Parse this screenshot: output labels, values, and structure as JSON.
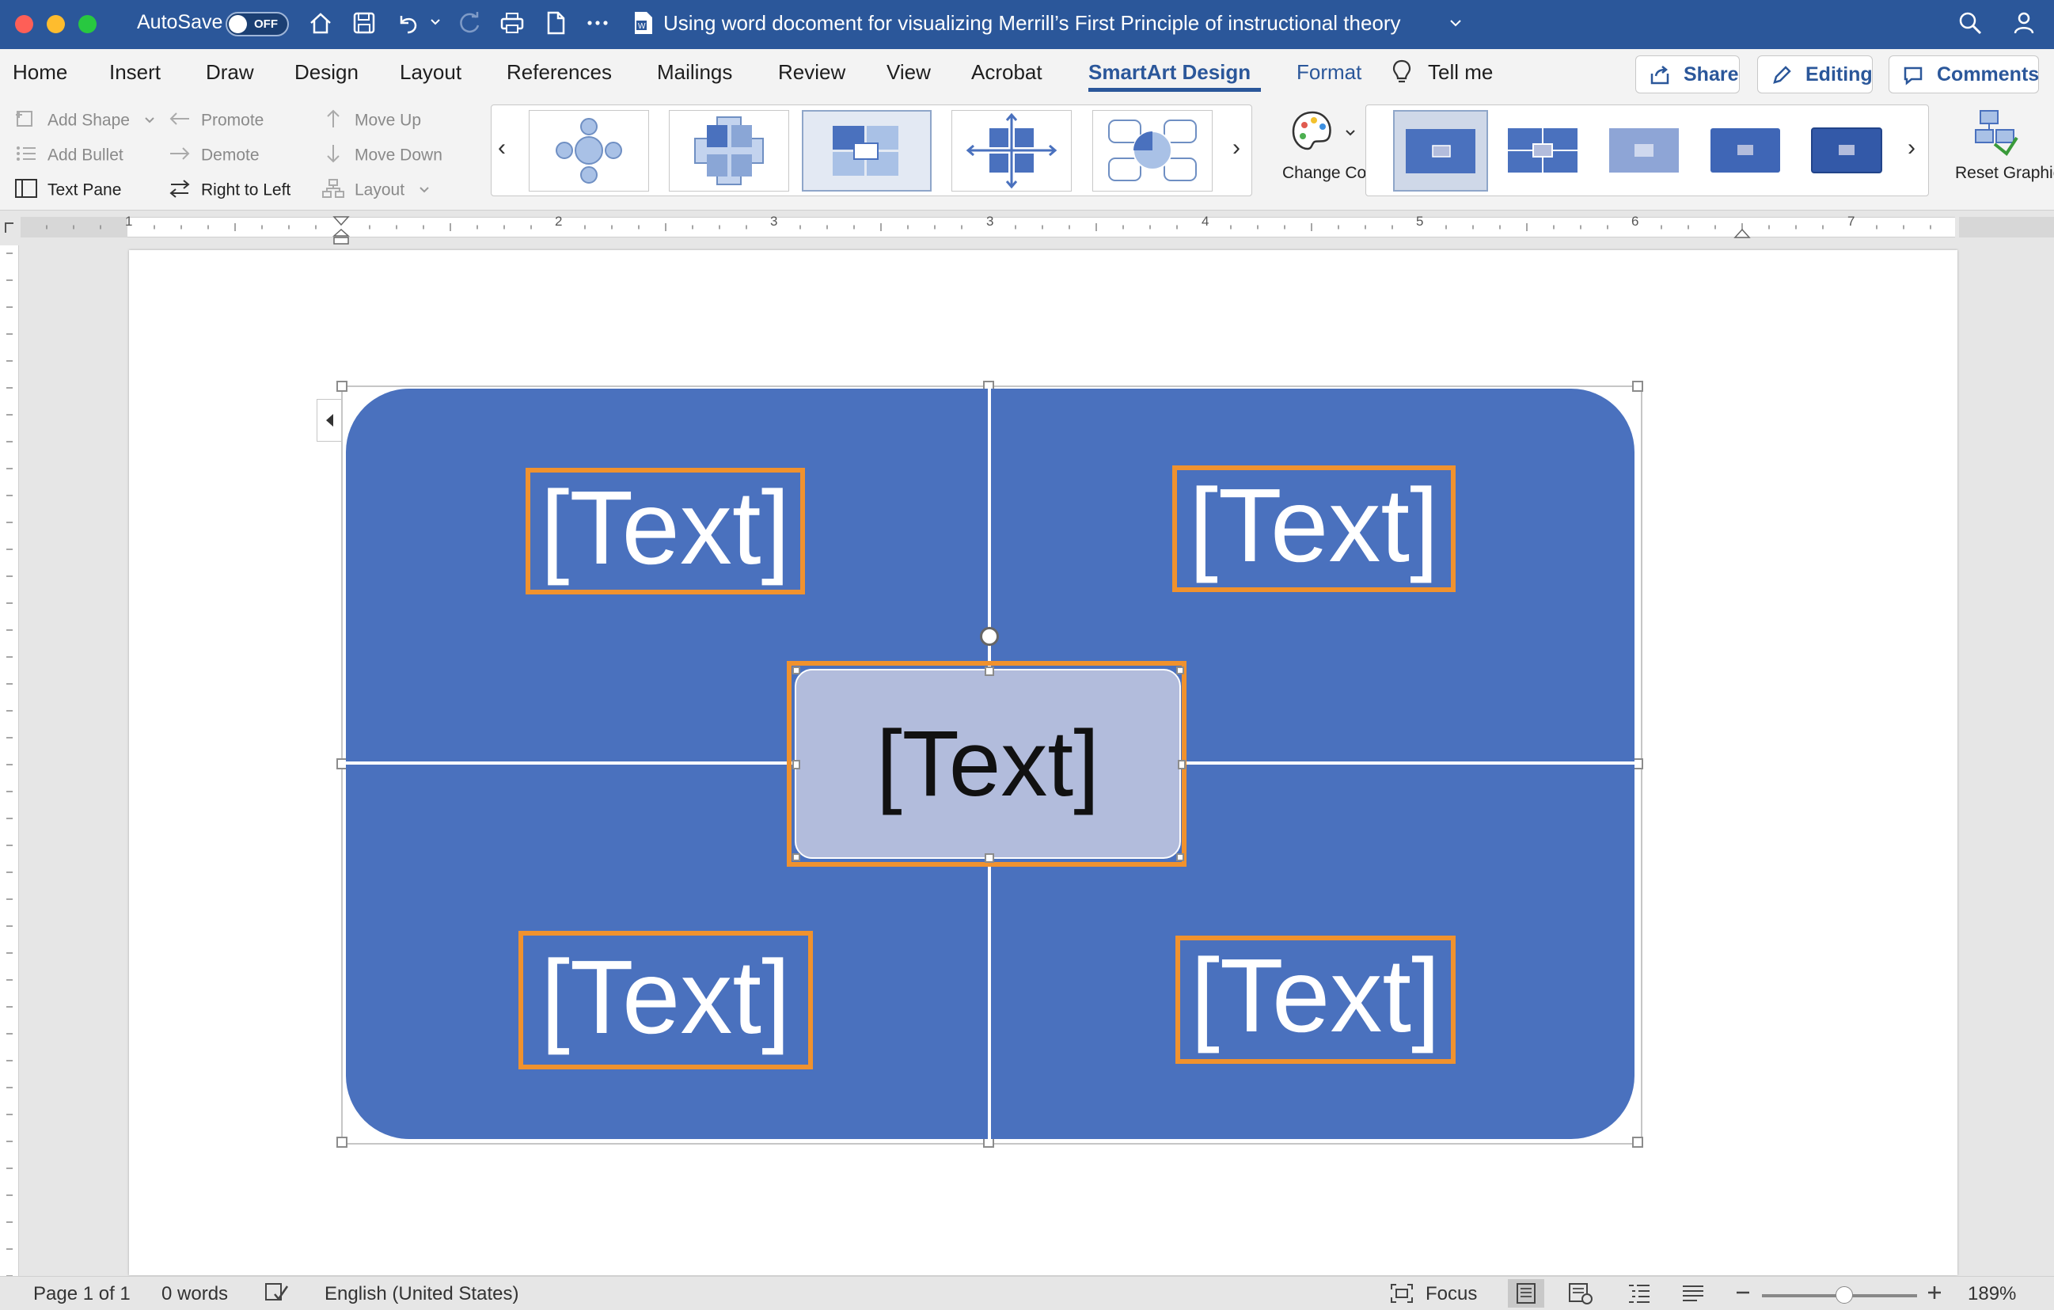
{
  "titlebar": {
    "autosave_label": "AutoSave",
    "autosave_state": "OFF",
    "document_title": "Using word docoment for visualizing Merrill’s First Principle of instructional theory"
  },
  "tabs": [
    {
      "label": "Home"
    },
    {
      "label": "Insert"
    },
    {
      "label": "Draw"
    },
    {
      "label": "Design"
    },
    {
      "label": "Layout"
    },
    {
      "label": "References"
    },
    {
      "label": "Mailings"
    },
    {
      "label": "Review"
    },
    {
      "label": "View"
    },
    {
      "label": "Acrobat"
    },
    {
      "label": "SmartArt Design"
    },
    {
      "label": "Format"
    },
    {
      "label": "Tell me"
    }
  ],
  "header_buttons": {
    "share": "Share",
    "editing": "Editing",
    "comments": "Comments"
  },
  "ribbon": {
    "create_graphic": {
      "add_shape": "Add Shape",
      "add_bullet": "Add Bullet",
      "text_pane": "Text Pane",
      "promote": "Promote",
      "demote": "Demote",
      "right_to_left": "Right to Left",
      "move_up": "Move Up",
      "move_down": "Move Down",
      "layout": "Layout"
    },
    "change_colors": "Change Colors",
    "reset_graphic": "Reset Graphic",
    "accent_color": "#4a71be"
  },
  "ruler": {
    "numbers": [
      "1",
      "1",
      "2",
      "3",
      "4",
      "5",
      "6",
      "7"
    ]
  },
  "smartart": {
    "top_left": "[Text]",
    "top_right": "[Text]",
    "center": "[Text]",
    "bottom_left": "[Text]",
    "bottom_right": "[Text]",
    "fill_color": "#4a71be",
    "center_fill": "#b2bcdc",
    "selection_color": "#f0922e"
  },
  "statusbar": {
    "page": "Page 1 of 1",
    "words": "0 words",
    "language": "English (United States)",
    "focus": "Focus",
    "zoom": "189%",
    "zoom_level": 0.53
  }
}
